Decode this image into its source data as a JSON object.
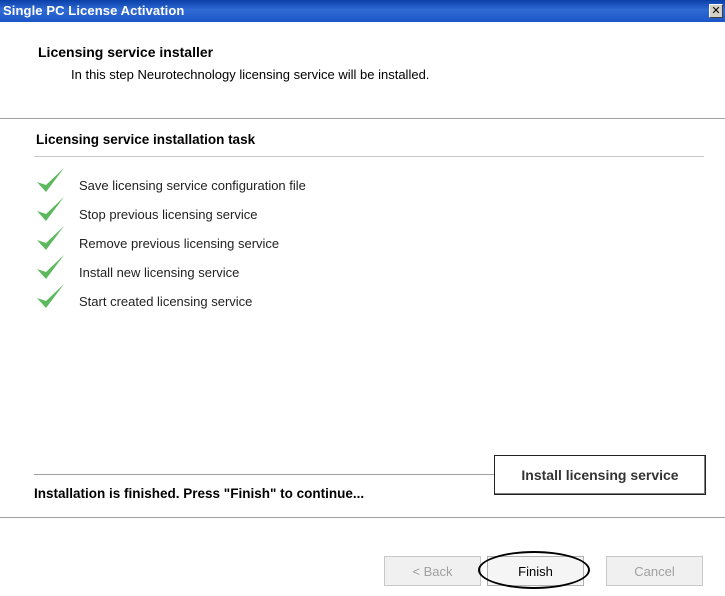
{
  "window": {
    "title": "Single PC License Activation",
    "close_glyph": "✕"
  },
  "header": {
    "title": "Licensing service installer",
    "subtitle": "In this step Neurotechnology licensing service will be installed."
  },
  "task": {
    "title": "Licensing service installation task",
    "steps": [
      {
        "label": "Save licensing service configuration file",
        "status": "done",
        "icon": "check-icon",
        "color": "#5cb85c"
      },
      {
        "label": "Stop previous licensing service",
        "status": "done",
        "icon": "check-icon",
        "color": "#5cb85c"
      },
      {
        "label": "Remove previous licensing service",
        "status": "done",
        "icon": "check-icon",
        "color": "#5cb85c"
      },
      {
        "label": "Install new licensing service",
        "status": "done",
        "icon": "check-icon",
        "color": "#5cb85c"
      },
      {
        "label": "Start created licensing service",
        "status": "done",
        "icon": "check-icon",
        "color": "#5cb85c"
      }
    ]
  },
  "status": {
    "text": "Installation is finished. Press \"Finish\" to continue...",
    "install_button": "Install licensing service"
  },
  "footer": {
    "back": "< Back",
    "finish": "Finish",
    "cancel": "Cancel"
  },
  "colors": {
    "titlebar": "#1c56c6",
    "check": "#5cb85c"
  }
}
